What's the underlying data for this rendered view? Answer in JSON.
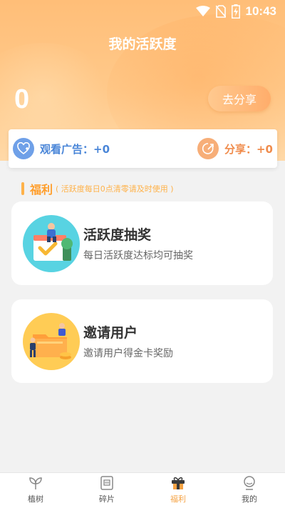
{
  "status_bar": {
    "time": "10:43"
  },
  "header": {
    "title": "我的活跃度",
    "score": "0",
    "share_button": "去分享"
  },
  "stats": {
    "ads": {
      "label": "观看广告：",
      "value": "+0"
    },
    "share": {
      "label": "分享：",
      "value": "+0"
    }
  },
  "section": {
    "title": "福利",
    "note": "( 活跃度每日0点清零请及时使用 )"
  },
  "cards": [
    {
      "title": "活跃度抽奖",
      "subtitle": "每日活跃度达标均可抽奖"
    },
    {
      "title": "邀请用户",
      "subtitle": "邀请用户得金卡奖励"
    }
  ],
  "bottom_nav": {
    "items": [
      {
        "label": "植树",
        "icon": "sprout-icon"
      },
      {
        "label": "碎片",
        "icon": "fragment-card-icon"
      },
      {
        "label": "福利",
        "icon": "gift-box-icon",
        "active": true
      },
      {
        "label": "我的",
        "icon": "user-profile-icon"
      }
    ]
  },
  "colors": {
    "accent": "#ffb24a",
    "header": "#ffc98a",
    "blue": "#4a86d8",
    "orange": "#f08c4c"
  }
}
